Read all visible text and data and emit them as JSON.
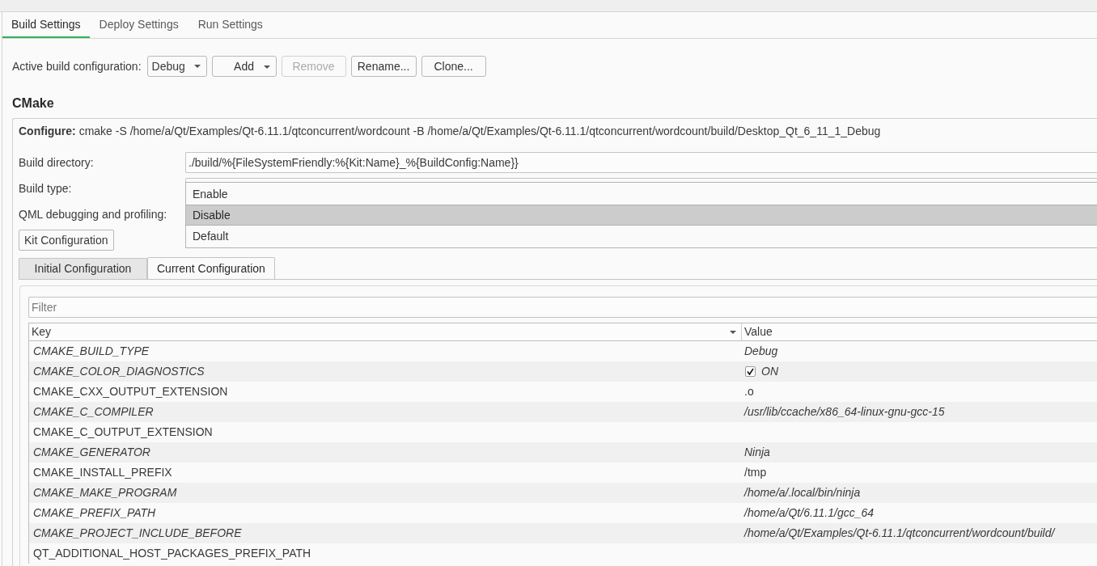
{
  "tabs": [
    {
      "label": "Build Settings",
      "selected": true
    },
    {
      "label": "Deploy Settings",
      "selected": false
    },
    {
      "label": "Run Settings",
      "selected": false
    }
  ],
  "build_configuration": {
    "label": "Active build configuration:",
    "combo": {
      "value": "Debug"
    },
    "buttons": [
      {
        "label": "Add",
        "kind": "menu",
        "disabled": false
      },
      {
        "label": "Remove",
        "kind": "push",
        "disabled": true
      },
      {
        "label": "Rename...",
        "kind": "push",
        "disabled": false
      },
      {
        "label": "Clone...",
        "kind": "push",
        "disabled": false
      }
    ]
  },
  "section_title": "CMake",
  "configure": "**Configure:** cmake -S /home/a/Qt/Examples/Qt-6.11.1/qtconcurrent/wordcount -B /home/a/Qt/Examples/Qt-6.11.1/qtconcurrent/wordcount/build/Desktop_Qt_6_11_1_Debug",
  "form": {
    "build_directory": {
      "label": "Build directory:",
      "value": "./build/%{FileSystemFriendly:%{Kit:Name}_%{BuildConfig:Name}}"
    },
    "build_type": {
      "label": "Build type:",
      "dropdown": {
        "options": [
          {
            "label": "Enable",
            "selected": false
          },
          {
            "label": "Disable",
            "selected": true
          },
          {
            "label": "Default",
            "selected": false
          }
        ]
      }
    },
    "qml_debugging": {
      "label": "QML debugging and profiling:"
    },
    "kit_configuration_button": "Kit Configuration"
  },
  "configuration_tabs": [
    {
      "label": "Initial Configuration",
      "selected": false
    },
    {
      "label": "Current Configuration",
      "selected": true
    }
  ],
  "filter": {
    "placeholder": "Filter"
  },
  "table": {
    "columns": [
      {
        "label": "Key",
        "sorted": true
      },
      {
        "label": "Value",
        "sorted": false
      }
    ],
    "rows": [
      {
        "key": "CMAKE_BUILD_TYPE",
        "kind": "text",
        "value": "Debug",
        "italic": true
      },
      {
        "key": "CMAKE_COLOR_DIAGNOSTICS",
        "kind": "bool",
        "checked": true,
        "value": "ON",
        "italic": true
      },
      {
        "key": "CMAKE_CXX_OUTPUT_EXTENSION",
        "kind": "text",
        "value": ".o",
        "italic": false
      },
      {
        "key": "CMAKE_C_COMPILER",
        "kind": "text",
        "value": "/usr/lib/ccache/x86_64-linux-gnu-gcc-15",
        "italic": true
      },
      {
        "key": "CMAKE_C_OUTPUT_EXTENSION",
        "kind": "text",
        "italic": false
      },
      {
        "key": "CMAKE_GENERATOR",
        "kind": "text",
        "value": "Ninja",
        "italic": true
      },
      {
        "key": "CMAKE_INSTALL_PREFIX",
        "kind": "text",
        "value": "/tmp",
        "italic": false
      },
      {
        "key": "CMAKE_MAKE_PROGRAM",
        "kind": "text",
        "value": "/home/a/.local/bin/ninja",
        "italic": true
      },
      {
        "key": "CMAKE_PREFIX_PATH",
        "kind": "text",
        "value": "/home/a/Qt/6.11.1/gcc_64",
        "italic": true
      },
      {
        "key": "CMAKE_PROJECT_INCLUDE_BEFORE",
        "kind": "text",
        "value": "/home/a/Qt/Examples/Qt-6.11.1/qtconcurrent/wordcount/build/",
        "italic": true
      },
      {
        "key": "QT_ADDITIONAL_HOST_PACKAGES_PREFIX_PATH",
        "kind": "text",
        "italic": false
      }
    ]
  }
}
